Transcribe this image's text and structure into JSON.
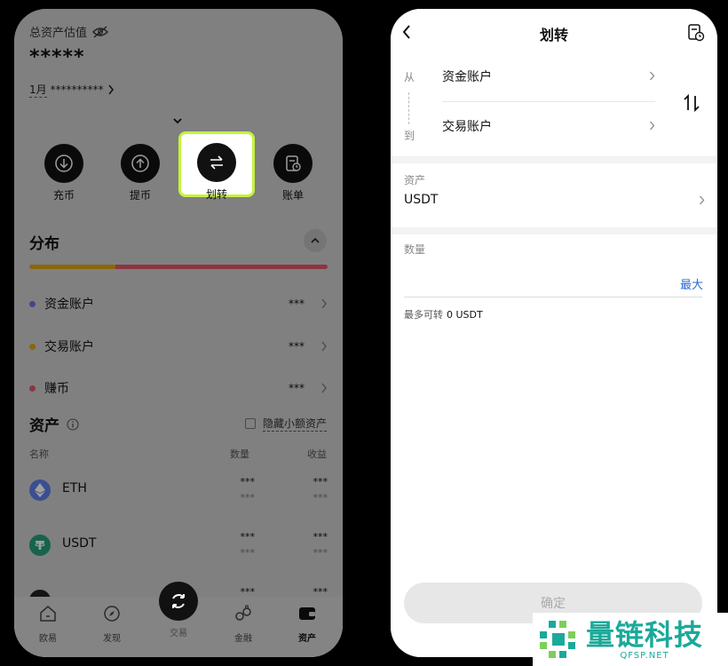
{
  "wallet": {
    "total_label": "总资产估值",
    "masked_total": "*****",
    "month_label": "1月",
    "month_masked": "**********",
    "actions": [
      {
        "label": "充币",
        "icon": "download-icon"
      },
      {
        "label": "提币",
        "icon": "upload-icon"
      },
      {
        "label": "划转",
        "icon": "transfer-icon"
      },
      {
        "label": "账单",
        "icon": "bill-icon"
      }
    ],
    "distribution_title": "分布",
    "distribution_accounts": [
      {
        "name": "资金账户",
        "value": "***",
        "color": "#6b72e0"
      },
      {
        "name": "交易账户",
        "value": "***",
        "color": "#e0a516"
      },
      {
        "name": "赚币",
        "value": "***",
        "color": "#e0586a"
      }
    ],
    "assets_title": "资产",
    "hide_small_label": "隐藏小额资产",
    "columns": {
      "name": "名称",
      "quantity": "数量",
      "profit": "收益"
    },
    "coins": [
      {
        "symbol": "ETH",
        "qty": "***",
        "qty_sub": "***",
        "profit": "***",
        "profit_sub": "***",
        "color": "#627eea"
      },
      {
        "symbol": "USDT",
        "qty": "***",
        "qty_sub": "***",
        "profit": "***",
        "profit_sub": "***",
        "color": "#26a17b"
      },
      {
        "symbol": "",
        "qty": "***",
        "qty_sub": "",
        "profit": "***",
        "profit_sub": "",
        "color": "#222222"
      }
    ],
    "nav": [
      {
        "label": "欧易",
        "icon": "home-icon"
      },
      {
        "label": "发现",
        "icon": "discover-icon"
      },
      {
        "label": "交易",
        "icon": "trade-icon"
      },
      {
        "label": "金融",
        "icon": "finance-icon"
      },
      {
        "label": "资产",
        "icon": "wallet-icon"
      }
    ]
  },
  "transfer": {
    "title": "划转",
    "from_label": "从",
    "to_label": "到",
    "from_account": "资金账户",
    "to_account": "交易账户",
    "asset_label": "资产",
    "asset_value": "USDT",
    "quantity_label": "数量",
    "quantity_value": "",
    "max_label": "最大",
    "max_transfer_label": "最多可转",
    "max_transfer_value": "0 USDT",
    "confirm_label": "确定"
  },
  "watermark": {
    "text": "量链科技",
    "sub": "QFSP.NET"
  },
  "colors": {
    "highlight_border": "#c5f23f",
    "link_blue": "#2a6bd6",
    "brand_teal": "#1aa99a"
  }
}
